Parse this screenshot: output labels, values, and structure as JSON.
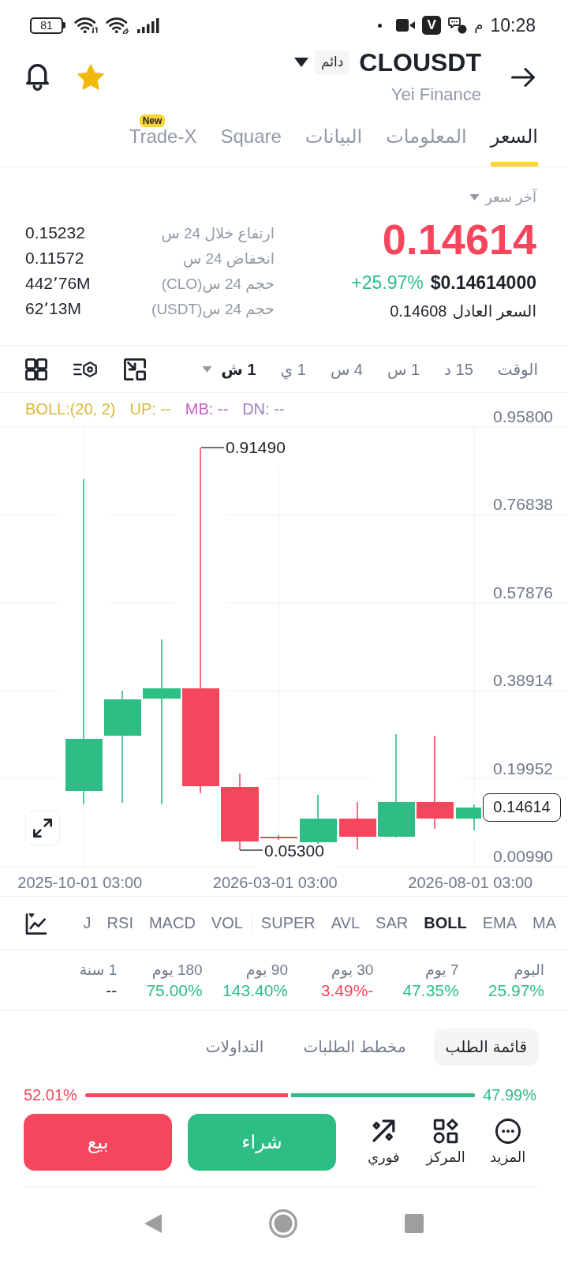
{
  "status_bar": {
    "battery": "81",
    "app_badge": "V",
    "period": "م",
    "time": "10:28"
  },
  "header": {
    "symbol": "CLOUSDT",
    "badge": "دائم",
    "subtitle": "Yei Finance",
    "favorite": true
  },
  "tabs": [
    {
      "label": "السعر",
      "selected": true
    },
    {
      "label": "المعلومات",
      "selected": false
    },
    {
      "label": "البيانات",
      "selected": false
    },
    {
      "label": "Square",
      "selected": false
    },
    {
      "label": "Trade-X",
      "selected": false,
      "badge": "New"
    }
  ],
  "price": {
    "label": "آخر سعر",
    "last": {
      "value": "0.14614",
      "falling": true
    },
    "usd": "$0.14614000",
    "change": {
      "value": "+25.97%",
      "falling": false
    },
    "fair_label": "السعر العادل",
    "fair_value": "0.14608",
    "stats": [
      {
        "label": "ارتفاع خلال 24 س",
        "value": "0.15232"
      },
      {
        "label": "انخفاض 24 س",
        "value": "0.11572"
      },
      {
        "label": "حجم 24 س(CLO)",
        "value": "442٬76M"
      },
      {
        "label": "حجم 24 س(USDT)",
        "value": "62٬13M"
      }
    ]
  },
  "intervals": {
    "label": "الوقت",
    "items": [
      {
        "label": "15 د",
        "selected": false
      },
      {
        "label": "1 س",
        "selected": false
      },
      {
        "label": "4 س",
        "selected": false
      },
      {
        "label": "1 ي",
        "selected": false
      },
      {
        "label": "1 ش",
        "selected": true
      }
    ]
  },
  "chart": {
    "legend": [
      {
        "text": "DN: --",
        "color": "#9a7fbf"
      },
      {
        "text": "MB: --",
        "color": "#c95ec6"
      },
      {
        "text": "UP: --",
        "color": "#dcb73c"
      },
      {
        "text": "BOLL:(20, 2)",
        "color": "#dcb73c"
      }
    ],
    "y_axis": [
      "0.95800",
      "0.76838",
      "0.57876",
      "0.38914",
      "0.19952",
      "0.00990"
    ],
    "x_axis": [
      "2026-08-01 03:00",
      "2026-03-01 03:00",
      "2025-10-01 03:00"
    ],
    "high_label": "0.91490",
    "low_label": "0.05300",
    "current_price": "0.14614"
  },
  "indicators": {
    "main": [
      {
        "label": "MA",
        "selected": false
      },
      {
        "label": "EMA",
        "selected": false
      },
      {
        "label": "BOLL",
        "selected": true
      },
      {
        "label": "SAR",
        "selected": false
      },
      {
        "label": "AVL",
        "selected": false
      },
      {
        "label": "SUPER",
        "selected": false
      }
    ],
    "sub": [
      {
        "label": "VOL",
        "selected": false
      },
      {
        "label": "MACD",
        "selected": false
      },
      {
        "label": "RSI",
        "selected": false
      },
      {
        "label": "J",
        "selected": false
      }
    ]
  },
  "performance": [
    {
      "period": "اليوم",
      "value": "25.97%",
      "color": "#2ebd85"
    },
    {
      "period": "7 يوم",
      "value": "47.35%",
      "color": "#2ebd85"
    },
    {
      "period": "30 يوم",
      "value": "3.49%-",
      "color": "#f6465d"
    },
    {
      "period": "90 يوم",
      "value": "143.40%",
      "color": "#2ebd85"
    },
    {
      "period": "180 يوم",
      "value": "75.00%",
      "color": "#2ebd85"
    },
    {
      "period": "1 سنة",
      "value": "--",
      "color": "#1e2329"
    }
  ],
  "order_book": {
    "tabs": [
      {
        "label": "قائمة الطلب",
        "selected": true
      },
      {
        "label": "مخطط الطلبات",
        "selected": false
      },
      {
        "label": "التداولات",
        "selected": false
      }
    ],
    "sell_share": "52.01%",
    "buy_share": "47.99%",
    "level": 0.4799
  },
  "actions": [
    {
      "kind": "more",
      "label": "المزيد"
    },
    {
      "kind": "position",
      "label": "المركز"
    },
    {
      "kind": "spot",
      "label": "فوري"
    }
  ],
  "trade_buttons": [
    {
      "kind": "buy",
      "label": "شراء"
    },
    {
      "kind": "sell",
      "label": "بيع"
    }
  ]
}
